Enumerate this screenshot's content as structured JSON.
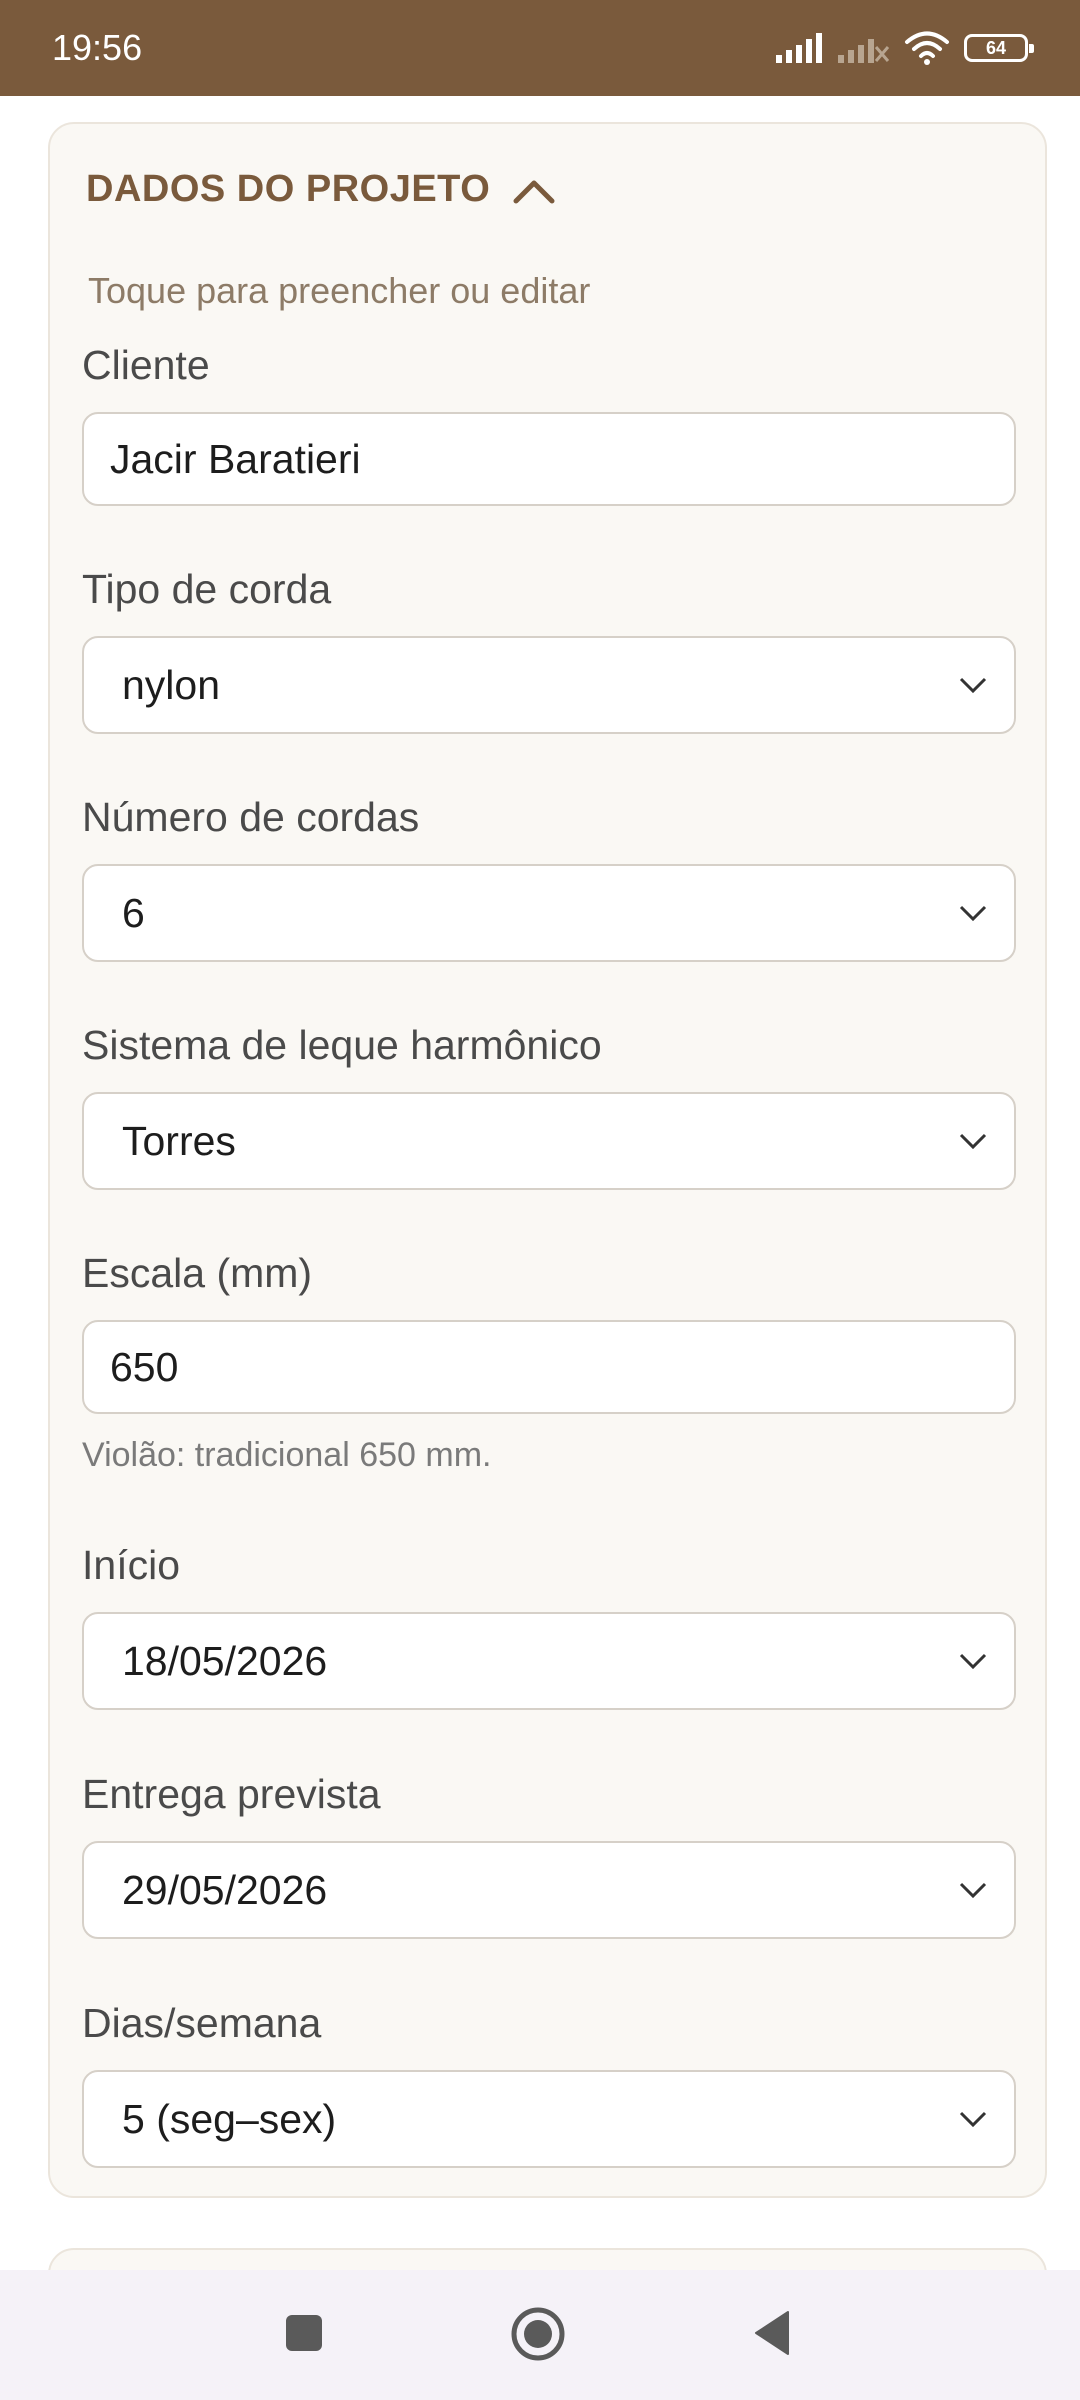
{
  "status_bar": {
    "time": "19:56",
    "battery": "64",
    "icons": [
      "signal-icon",
      "no-signal-icon",
      "wifi-icon",
      "battery-icon"
    ]
  },
  "section": {
    "title": "DADOS DO PROJETO",
    "hint": "Toque para preencher ou editar",
    "expanded": true
  },
  "fields": {
    "cliente": {
      "label": "Cliente",
      "value": "Jacir Baratieri"
    },
    "tipo_corda": {
      "label": "Tipo de corda",
      "value": "nylon"
    },
    "numero_cordas": {
      "label": "Número de cordas",
      "value": "6"
    },
    "leque": {
      "label": "Sistema de leque harmônico",
      "value": "Torres"
    },
    "escala": {
      "label": "Escala (mm)",
      "value": "650",
      "help": "Violão: tradicional 650 mm."
    },
    "inicio": {
      "label": "Início",
      "value": "18/05/2026"
    },
    "entrega": {
      "label": "Entrega prevista",
      "value": "29/05/2026"
    },
    "dias_semana": {
      "label": "Dias/semana",
      "value": "5 (seg–sex)"
    }
  },
  "nav_bar": {
    "icons": [
      "recents-icon",
      "home-icon",
      "back-icon"
    ]
  },
  "colors": {
    "brand": "#7a5a3c",
    "card_bg": "#faf8f4",
    "hint": "#8d7b67"
  }
}
